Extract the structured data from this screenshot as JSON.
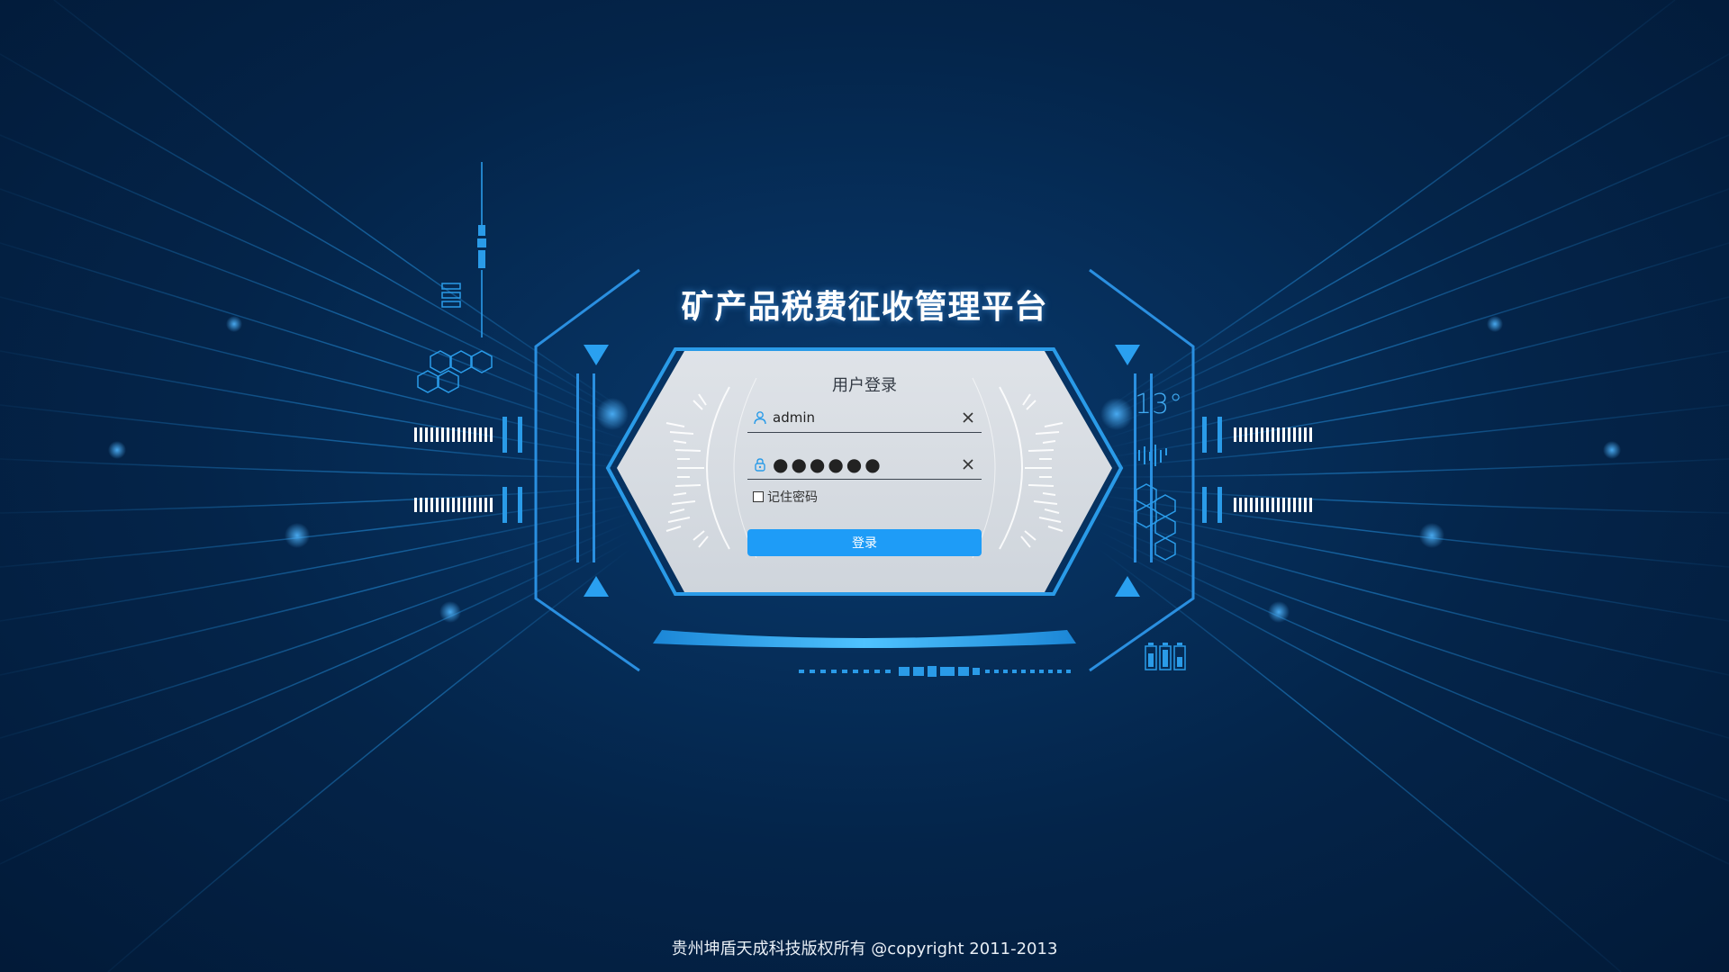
{
  "header": {
    "title": "矿产品税费征收管理平台"
  },
  "login": {
    "heading": "用户登录",
    "username": {
      "value": "admin",
      "icon": "user-icon"
    },
    "password": {
      "value": "●●●●●●",
      "icon": "lock-icon"
    },
    "remember_label": "记住密码",
    "remember_checked": false,
    "submit_label": "登录"
  },
  "hud": {
    "temperature": "13°"
  },
  "footer": {
    "copyright": "贵州坤盾天成科技版权所有 @copyright 2011-2013"
  },
  "colors": {
    "background": "#042449",
    "accent": "#1e9cf7",
    "hud_blue": "#2a8fe0",
    "panel": "#d7dde3"
  }
}
